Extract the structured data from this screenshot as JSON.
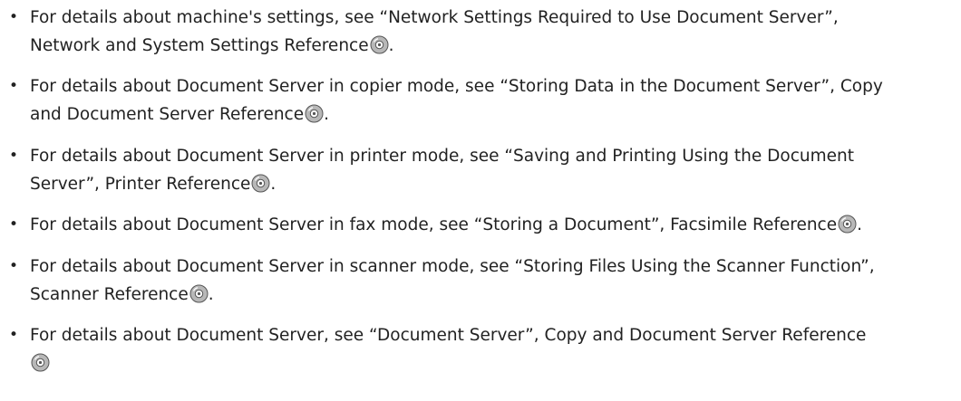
{
  "items": [
    {
      "lines": [
        "For details about machine's settings, see “Network Settings Required to Use Document Server”,",
        "Network and System Settings Reference"
      ],
      "after_icon": "."
    },
    {
      "lines": [
        "For details about Document Server in copier mode, see “Storing Data in the Document Server”, Copy",
        "and Document Server Reference"
      ],
      "after_icon": "."
    },
    {
      "lines": [
        "For details about Document Server in printer mode, see “Saving and Printing Using the Document",
        "Server”, Printer Reference"
      ],
      "after_icon": "."
    },
    {
      "lines": [
        "For details about Document Server in fax mode, see “Storing a Document”, Facsimile Reference"
      ],
      "after_icon": "."
    },
    {
      "lines": [
        "For details about Document Server in scanner mode, see “Storing Files Using the Scanner Function”,",
        "Scanner Reference"
      ],
      "after_icon": "."
    },
    {
      "lines": [
        "For details about Document Server, see “Document Server”, Copy and Document Server Reference",
        ""
      ],
      "after_icon": ""
    }
  ],
  "bullet_char": "•",
  "icon": "cd-rom-icon",
  "colors": {
    "text": "#222222",
    "icon_fill": "#b8b8b8",
    "icon_stroke": "#555555"
  }
}
